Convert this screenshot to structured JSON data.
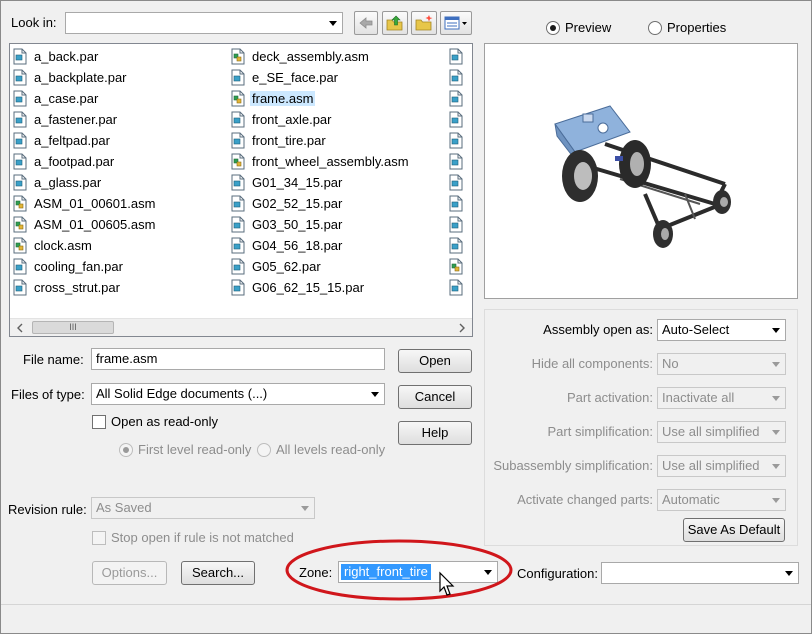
{
  "look_in": {
    "label": "Look in:",
    "value": ""
  },
  "toolbar": {
    "icons": [
      "back-arrow-icon",
      "up-folder-icon",
      "new-folder-icon",
      "view-menu-icon"
    ]
  },
  "file_list": {
    "columns": [
      [
        {
          "name": "a_back.par",
          "icon": "part-file-icon"
        },
        {
          "name": "a_backplate.par",
          "icon": "part-file-icon"
        },
        {
          "name": "a_case.par",
          "icon": "part-file-icon"
        },
        {
          "name": "a_fastener.par",
          "icon": "part-file-icon"
        },
        {
          "name": "a_feltpad.par",
          "icon": "part-file-icon"
        },
        {
          "name": "a_footpad.par",
          "icon": "part-file-icon"
        },
        {
          "name": "a_glass.par",
          "icon": "part-file-icon"
        },
        {
          "name": "ASM_01_00601.asm",
          "icon": "assembly-file-icon"
        },
        {
          "name": "ASM_01_00605.asm",
          "icon": "assembly-file-icon"
        },
        {
          "name": "clock.asm",
          "icon": "assembly-file-icon"
        },
        {
          "name": "cooling_fan.par",
          "icon": "part-file-icon"
        },
        {
          "name": "cross_strut.par",
          "icon": "part-file-icon"
        }
      ],
      [
        {
          "name": "deck_assembly.asm",
          "icon": "assembly-file-icon"
        },
        {
          "name": "e_SE_face.par",
          "icon": "part-file-icon"
        },
        {
          "name": "frame.asm",
          "icon": "assembly-file-icon",
          "selected": true
        },
        {
          "name": "front_axle.par",
          "icon": "part-file-icon"
        },
        {
          "name": "front_tire.par",
          "icon": "part-file-icon"
        },
        {
          "name": "front_wheel_assembly.asm",
          "icon": "assembly-file-icon"
        },
        {
          "name": "G01_34_15.par",
          "icon": "part-file-icon"
        },
        {
          "name": "G02_52_15.par",
          "icon": "part-file-icon"
        },
        {
          "name": "G03_50_15.par",
          "icon": "part-file-icon"
        },
        {
          "name": "G04_56_18.par",
          "icon": "part-file-icon"
        },
        {
          "name": "G05_62.par",
          "icon": "part-file-icon"
        },
        {
          "name": "G06_62_15_15.par",
          "icon": "part-file-icon"
        }
      ]
    ],
    "scroll_thumb_glyph": "III"
  },
  "preview_options": {
    "preview_label": "Preview",
    "properties_label": "Properties",
    "selected": "Preview"
  },
  "file_name": {
    "label": "File name:",
    "value": "frame.asm"
  },
  "files_of_type": {
    "label": "Files of type:",
    "value": "All Solid Edge documents (...)"
  },
  "read_only": {
    "open_label": "Open as read-only",
    "first_level_label": "First level read-only",
    "all_levels_label": "All levels read-only"
  },
  "buttons": {
    "open": "Open",
    "cancel": "Cancel",
    "help": "Help",
    "options": "Options...",
    "search": "Search...",
    "save_default": "Save As Default"
  },
  "revision_rule": {
    "label": "Revision rule:",
    "value": "As Saved",
    "stop_label": "Stop open if rule is not matched"
  },
  "assembly_options": [
    {
      "label": "Assembly open as:",
      "value": "Auto-Select",
      "enabled": true
    },
    {
      "label": "Hide all components:",
      "value": "No",
      "enabled": false
    },
    {
      "label": "Part activation:",
      "value": "Inactivate all",
      "enabled": false
    },
    {
      "label": "Part simplification:",
      "value": "Use all simplified",
      "enabled": false
    },
    {
      "label": "Subassembly simplification:",
      "value": "Use all simplified",
      "enabled": false
    },
    {
      "label": "Activate changed parts:",
      "value": "Automatic",
      "enabled": false
    }
  ],
  "zone": {
    "label": "Zone:",
    "value": "right_front_tire"
  },
  "configuration": {
    "label": "Configuration:",
    "value": ""
  },
  "colors": {
    "highlight_ring": "#d0161b",
    "selection": "#3399ff",
    "item_selected": "#cce8ff"
  }
}
